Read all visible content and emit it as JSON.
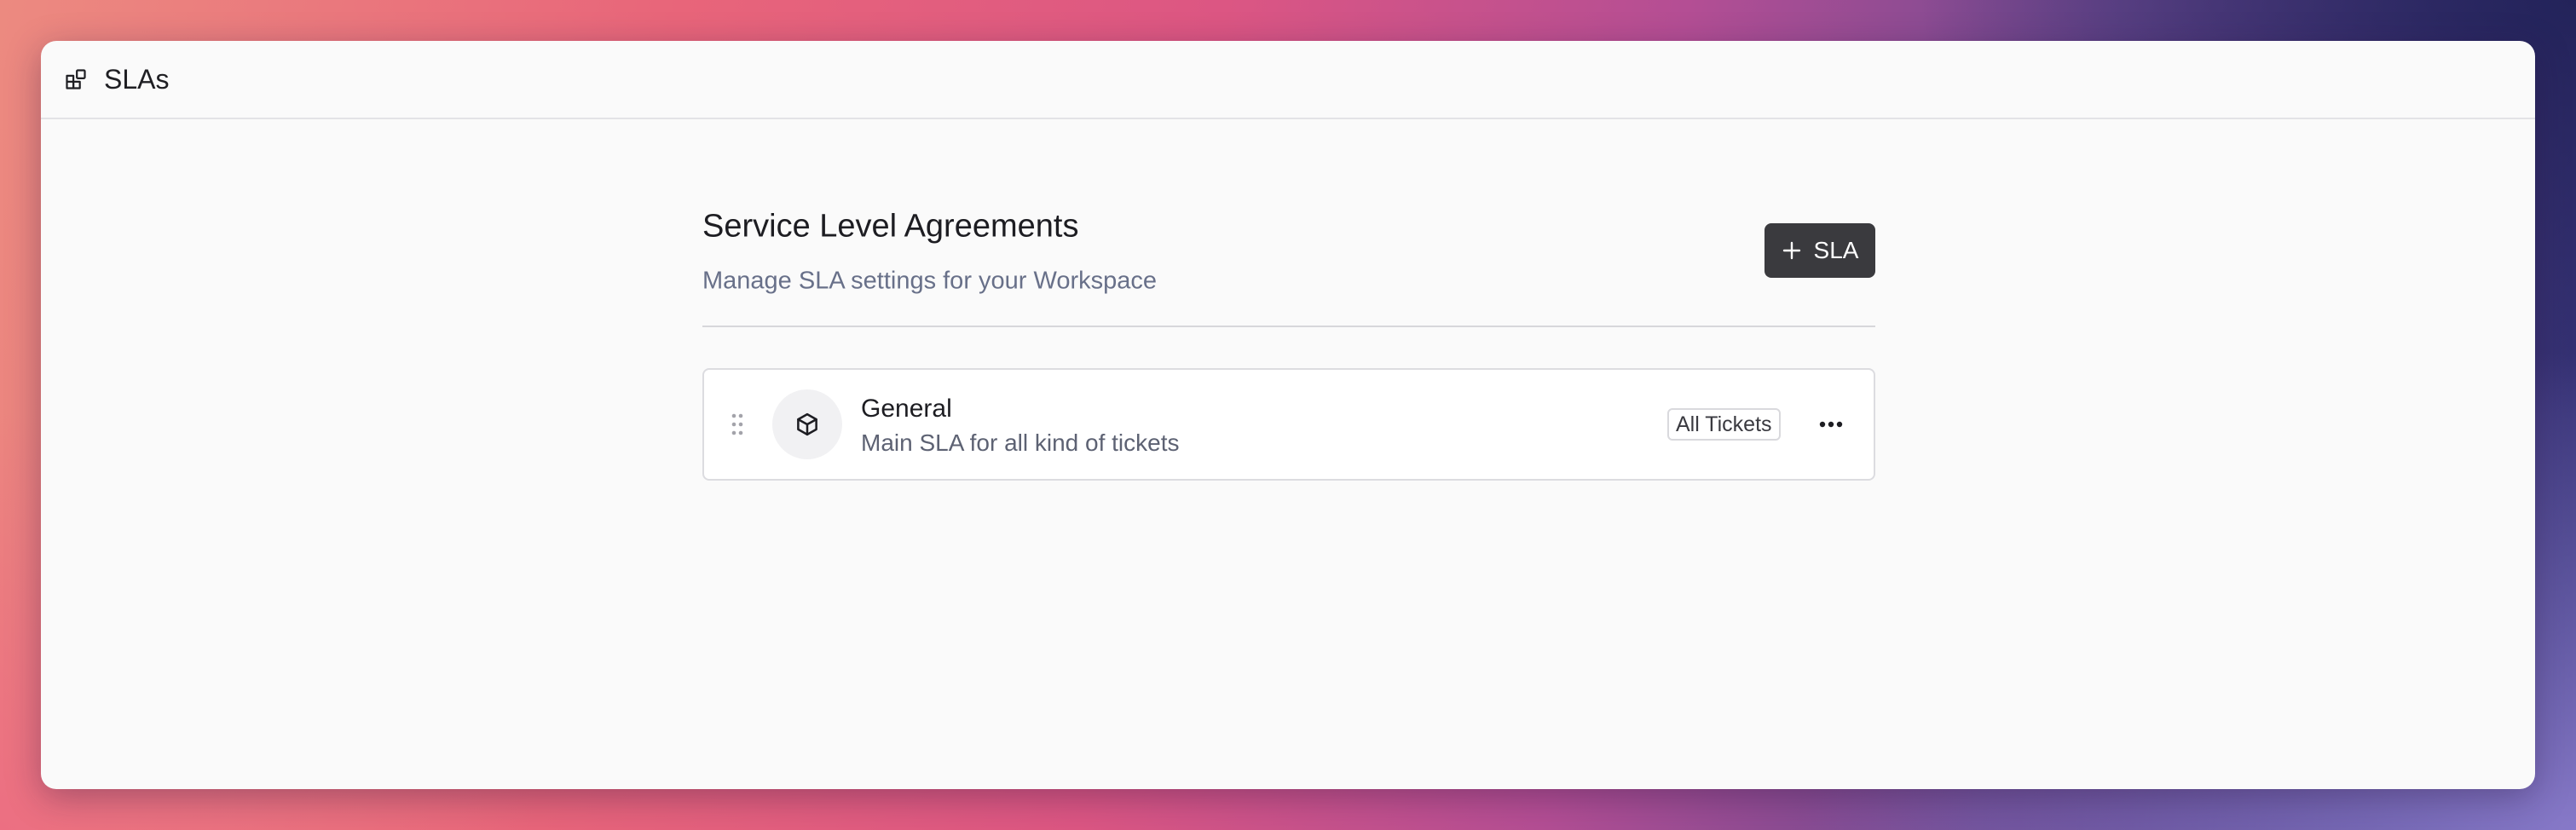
{
  "topbar": {
    "icon": "blocks-icon",
    "title": "SLAs"
  },
  "page": {
    "title": "Service Level Agreements",
    "subtitle": "Manage SLA settings for your Workspace"
  },
  "actions": {
    "add_button_icon": "plus-icon",
    "add_button_label": "SLA"
  },
  "sla_list": [
    {
      "icon": "box-icon",
      "name": "General",
      "description": "Main SLA for all kind of tickets",
      "badge": "All Tickets",
      "menu_icon": "ellipsis-horizontal-icon"
    }
  ],
  "colors": {
    "primary_button": "#3a3a3e",
    "window_background": "#fafafa",
    "subtitle_text": "#687089"
  }
}
